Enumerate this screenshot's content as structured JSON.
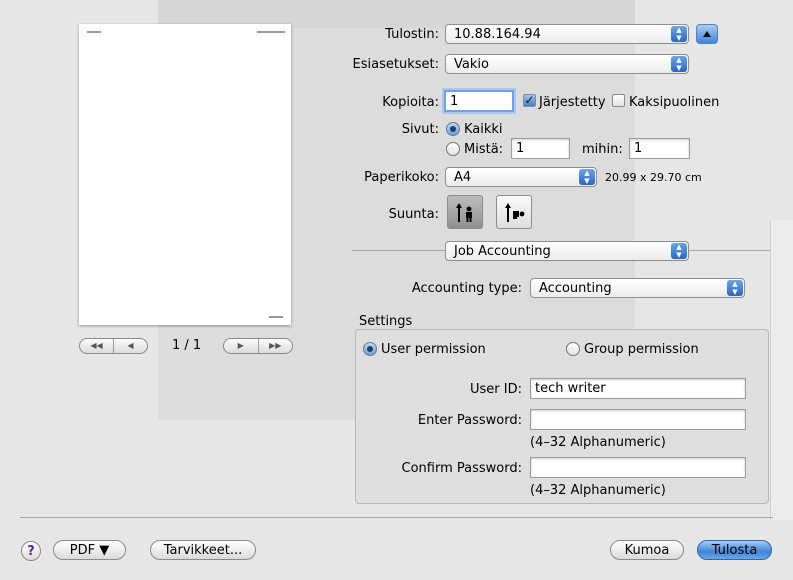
{
  "preview": {
    "page_indicator": "1 / 1"
  },
  "printer": {
    "label": "Tulostin:",
    "value": "10.88.164.94"
  },
  "presets": {
    "label": "Esiasetukset:",
    "value": "Vakio"
  },
  "copies": {
    "label": "Kopioita:",
    "value": "1",
    "collated_label": "Järjestetty",
    "collated_checked": true,
    "two_sided_label": "Kaksipuolinen",
    "two_sided_checked": false
  },
  "pages": {
    "label": "Sivut:",
    "all_label": "Kaikki",
    "from_label": "Mistä:",
    "from_value": "1",
    "to_label": "mihin:",
    "to_value": "1",
    "selected": "all"
  },
  "paper": {
    "label": "Paperikoko:",
    "value": "A4",
    "dimensions": "20.99 x 29.70 cm"
  },
  "orientation": {
    "label": "Suunta:",
    "selected": "portrait"
  },
  "panel_popup": {
    "value": "Job Accounting"
  },
  "accounting": {
    "type_label": "Accounting type:",
    "type_value": "Accounting",
    "settings_label": "Settings",
    "user_permission_label": "User permission",
    "group_permission_label": "Group permission",
    "selected_permission": "user",
    "user_id_label": "User ID:",
    "user_id_value": "tech writer",
    "enter_password_label": "Enter Password:",
    "enter_password_hint": "(4–32 Alphanumeric)",
    "confirm_password_label": "Confirm Password:",
    "confirm_password_hint": "(4–32 Alphanumeric)"
  },
  "footer": {
    "help": "?",
    "pdf": "PDF ▼",
    "supplies": "Tarvikkeet...",
    "cancel": "Kumoa",
    "print": "Tulosta"
  },
  "colors": {
    "accent": "#3f85d8",
    "background": "#e6e6e6"
  }
}
